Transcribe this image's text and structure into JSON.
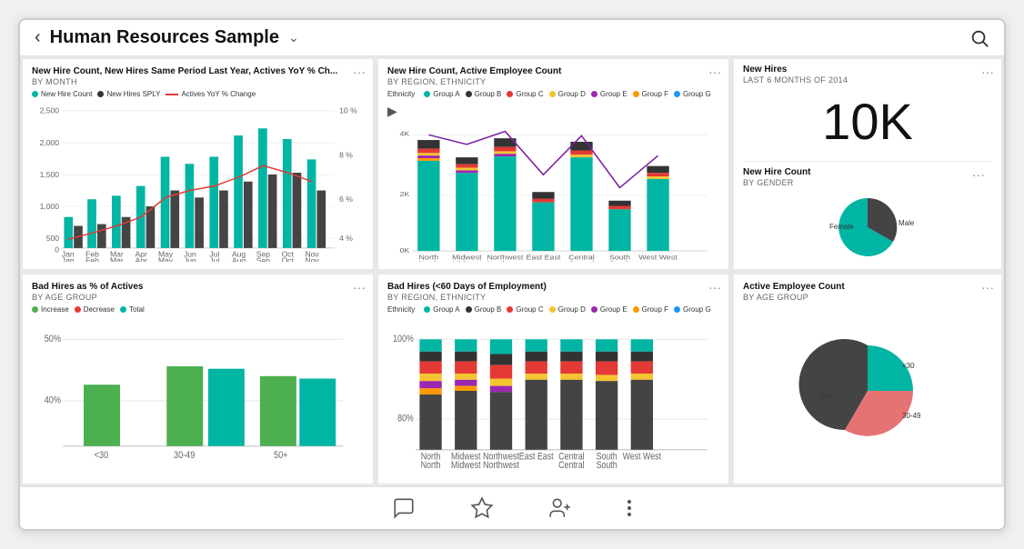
{
  "header": {
    "back_label": "‹",
    "title": "Human Resources Sample",
    "chevron": "˅",
    "search_icon": "🔍"
  },
  "cards": {
    "chart1": {
      "title": "New Hire Count, New Hires Same Period Last Year, Actives YoY % Ch...",
      "subtitle": "BY MONTH",
      "legend": [
        {
          "label": "New Hire Count",
          "color": "#00b5a4",
          "type": "dot"
        },
        {
          "label": "New Hires SPLY",
          "color": "#333",
          "type": "dot"
        },
        {
          "label": "Actives YoY % Change",
          "color": "#e53935",
          "type": "line"
        }
      ],
      "y_labels": [
        "2,500",
        "2,000",
        "1,500",
        "1,000",
        "500",
        "0"
      ],
      "x_labels": [
        "Jan\nJan",
        "Feb\nFeb",
        "Mar\nMar",
        "Apr\nApr",
        "May\nMay",
        "Jun\nJun",
        "Jul\nJul",
        "Aug\nAug",
        "Sep\nSep",
        "Oct\nOct",
        "Nov\nNov"
      ],
      "y2_labels": [
        "10 %",
        "8 %",
        "6 %",
        "4 %"
      ]
    },
    "chart2": {
      "title": "New Hire Count, Active Employee Count",
      "subtitle": "BY REGION, ETHNICITY",
      "legend_label": "Ethnicity",
      "legend_items": [
        {
          "label": "Group A",
          "color": "#00b5a4"
        },
        {
          "label": "Group B",
          "color": "#333"
        },
        {
          "label": "Group C",
          "color": "#e53935"
        },
        {
          "label": "Group D",
          "color": "#f4c430"
        },
        {
          "label": "Group E",
          "color": "#9c27b0"
        },
        {
          "label": "Group F",
          "color": "#ff9800"
        },
        {
          "label": "Group G",
          "color": "#2196f3"
        }
      ],
      "x_labels": [
        "North\nNorth",
        "Midwest\nMidwest",
        "Northwest\nNorthwest",
        "East East",
        "Central\nCentral",
        "South\nSouth",
        "West West"
      ],
      "y_labels": [
        "4K",
        "2K",
        "0K"
      ]
    },
    "new_hires": {
      "title": "New Hires",
      "subtitle": "LAST 6 MONTHS OF 2014",
      "count": "10K"
    },
    "hire_count_gender": {
      "title": "New Hire Count",
      "subtitle": "BY GENDER",
      "female_label": "Female",
      "male_label": "Male"
    },
    "chart3": {
      "title": "Bad Hires as % of Actives",
      "subtitle": "BY AGE GROUP",
      "legend": [
        {
          "label": "Increase",
          "color": "#4caf50"
        },
        {
          "label": "Decrease",
          "color": "#e53935"
        },
        {
          "label": "Total",
          "color": "#00b5a4"
        }
      ],
      "y_labels": [
        "50%",
        "40%"
      ],
      "x_labels": [
        "<30",
        "30-49",
        "50+"
      ]
    },
    "chart4": {
      "title": "Bad Hires (<60 Days of Employment)",
      "subtitle": "BY REGION, ETHNICITY",
      "legend_label": "Ethnicity",
      "legend_items": [
        {
          "label": "Group A",
          "color": "#00b5a4"
        },
        {
          "label": "Group B",
          "color": "#333"
        },
        {
          "label": "Group C",
          "color": "#e53935"
        },
        {
          "label": "Group D",
          "color": "#f4c430"
        },
        {
          "label": "Group E",
          "color": "#9c27b0"
        },
        {
          "label": "Group F",
          "color": "#ff9800"
        },
        {
          "label": "Group G",
          "color": "#2196f3"
        }
      ],
      "y_labels": [
        "100%",
        "80%"
      ],
      "x_labels": [
        "North\nNorth",
        "Midwest\nMidwest",
        "Northwest\nNorthwest",
        "East East",
        "Central\nCentral",
        "South\nSouth",
        "West West"
      ]
    },
    "chart5": {
      "title": "Active Employee Count",
      "subtitle": "BY AGE GROUP",
      "labels": {
        "lt30": "<30",
        "age30_49": "30-49",
        "age50plus": "50+"
      }
    }
  },
  "toolbar": {
    "comment_icon": "💬",
    "star_icon": "☆",
    "person_icon": "👤",
    "more_icon": "⋮"
  }
}
